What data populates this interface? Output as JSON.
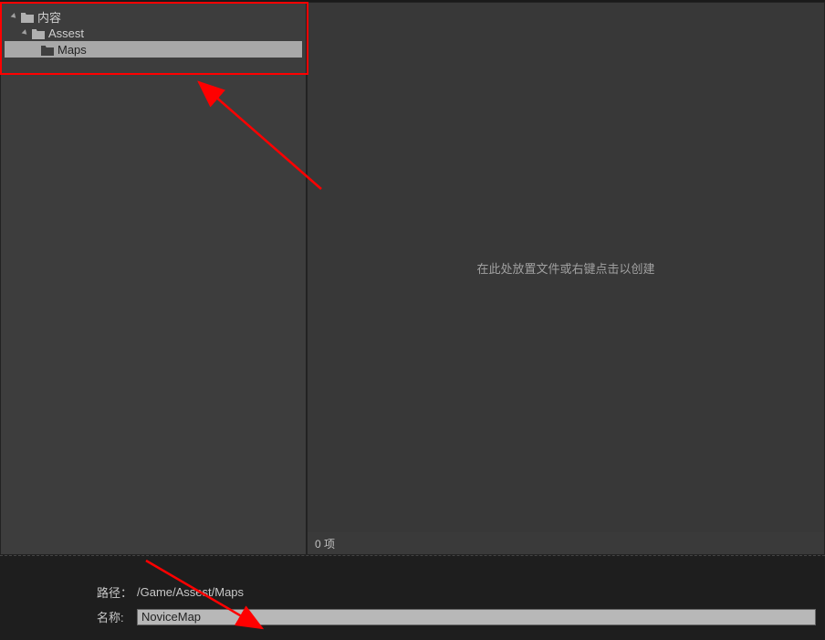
{
  "tree": {
    "items": [
      {
        "label": "内容",
        "level": 1,
        "expanded": true,
        "selected": false
      },
      {
        "label": "Assest",
        "level": 2,
        "expanded": true,
        "selected": false
      },
      {
        "label": "Maps",
        "level": 3,
        "expanded": false,
        "selected": true
      }
    ]
  },
  "content": {
    "drop_hint": "在此处放置文件或右键点击以创建",
    "status": "0 项"
  },
  "form": {
    "path_label": "路径：",
    "path_value": "/Game/Assest/Maps",
    "name_label": "名称:",
    "name_value": "NoviceMap"
  }
}
